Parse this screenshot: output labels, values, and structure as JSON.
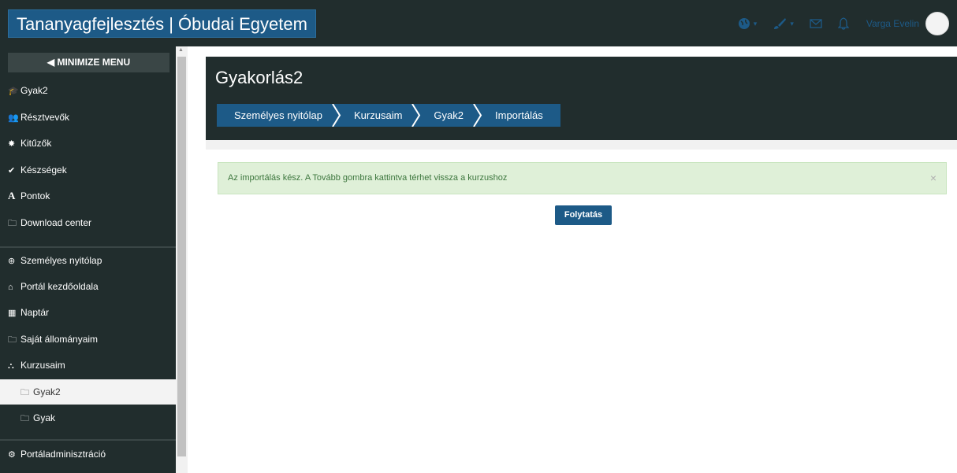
{
  "header": {
    "brand": "Tananyagfejlesztés | Óbudai Egyetem",
    "user_name": "Varga Evelin",
    "icons": [
      "globe-icon",
      "paintbrush-icon",
      "envelope-icon",
      "bell-icon"
    ]
  },
  "sidebar": {
    "minimize_label": "MINIMIZE MENU",
    "course_items": [
      {
        "label": "Gyak2",
        "icon": "graduation-cap-icon"
      },
      {
        "label": "Résztvevők",
        "icon": "users-icon"
      },
      {
        "label": "Kitűzők",
        "icon": "badge-icon"
      },
      {
        "label": "Készségek",
        "icon": "check-circle-icon"
      },
      {
        "label": "Pontok",
        "icon": "grade-icon"
      },
      {
        "label": "Download center",
        "icon": "folder-icon"
      }
    ],
    "nav_items": [
      {
        "label": "Személyes nyitólap",
        "icon": "dashboard-icon"
      },
      {
        "label": "Portál kezdőoldala",
        "icon": "home-icon"
      },
      {
        "label": "Naptár",
        "icon": "calendar-icon"
      },
      {
        "label": "Saját állományaim",
        "icon": "folder-icon"
      },
      {
        "label": "Kurzusaim",
        "icon": "sitemap-icon"
      },
      {
        "label": "Gyak2",
        "icon": "folder-icon",
        "active": true
      },
      {
        "label": "Gyak",
        "icon": "folder-icon"
      }
    ],
    "admin_item": {
      "label": "Portáladminisztráció",
      "icon": "cogs-icon"
    }
  },
  "main": {
    "title": "Gyakorlás2",
    "breadcrumbs": [
      "Személyes nyitólap",
      "Kurzusaim",
      "Gyak2",
      "Importálás"
    ],
    "alert_text": "Az importálás kész. A Tovább gombra kattintva térhet vissza a kurzushoz",
    "alert_close": "×",
    "continue_button": "Folytatás"
  },
  "colors": {
    "navbar": "#212d2d",
    "brand_blue": "#1d5a87",
    "alert_bg": "#dff0d8",
    "alert_text": "#3c763d"
  }
}
